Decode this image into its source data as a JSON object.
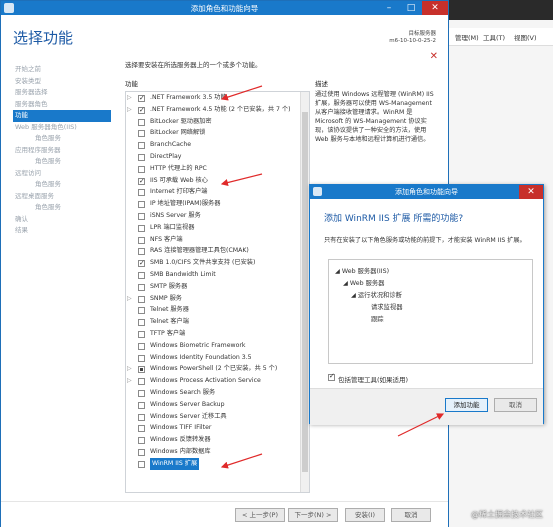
{
  "main_window": {
    "title": "添加角色和功能向导",
    "page_title": "选择功能",
    "dest_label": "目标服务器",
    "dest_server": "m6-10-10-0-25-2",
    "intro": "选择要安装在所选服务器上的一个或多个功能。",
    "features_header": "功能",
    "description_header": "描述",
    "description": "通过使用 Windows 远程管理 (WinRM) IIS 扩展，服务器可以使用 WS-Management 从客户端接收管理请求。WinRM 是 Microsoft 的 WS-Management 协议实现，该协议提供了一种安全的方法，使用 Web 服务与本地和远程计算机进行通信。"
  },
  "nav": [
    {
      "label": "开始之前",
      "sub": false,
      "active": false
    },
    {
      "label": "安装类型",
      "sub": false,
      "active": false
    },
    {
      "label": "服务器选择",
      "sub": false,
      "active": false
    },
    {
      "label": "服务器角色",
      "sub": false,
      "active": false
    },
    {
      "label": "功能",
      "sub": false,
      "active": true
    },
    {
      "label": "Web 服务器角色(IIS)",
      "sub": false,
      "active": false
    },
    {
      "label": "角色服务",
      "sub": true,
      "active": false
    },
    {
      "label": "应用程序服务器",
      "sub": false,
      "active": false
    },
    {
      "label": "角色服务",
      "sub": true,
      "active": false
    },
    {
      "label": "远程访问",
      "sub": false,
      "active": false
    },
    {
      "label": "角色服务",
      "sub": true,
      "active": false
    },
    {
      "label": "远程桌面服务",
      "sub": false,
      "active": false
    },
    {
      "label": "角色服务",
      "sub": true,
      "active": false
    },
    {
      "label": "确认",
      "sub": false,
      "active": false
    },
    {
      "label": "结果",
      "sub": false,
      "active": false
    }
  ],
  "features": [
    {
      "label": ".NET Framework 3.5 功能",
      "state": "checked",
      "expandable": true
    },
    {
      "label": ".NET Framework 4.5 功能 (2 个已安装，共 7 个)",
      "state": "checked",
      "expandable": true
    },
    {
      "label": "BitLocker 驱动器加密",
      "state": "unchecked",
      "expandable": false
    },
    {
      "label": "BitLocker 网络解锁",
      "state": "unchecked",
      "expandable": false
    },
    {
      "label": "BranchCache",
      "state": "unchecked",
      "expandable": false
    },
    {
      "label": "DirectPlay",
      "state": "unchecked",
      "expandable": false
    },
    {
      "label": "HTTP 代理上的 RPC",
      "state": "unchecked",
      "expandable": false
    },
    {
      "label": "IIS 可承载 Web 核心",
      "state": "checked",
      "expandable": false
    },
    {
      "label": "Internet 打印客户端",
      "state": "unchecked",
      "expandable": false
    },
    {
      "label": "IP 地址管理(IPAM)服务器",
      "state": "unchecked",
      "expandable": false
    },
    {
      "label": "iSNS Server 服务",
      "state": "unchecked",
      "expandable": false
    },
    {
      "label": "LPR 端口监视器",
      "state": "unchecked",
      "expandable": false
    },
    {
      "label": "NFS 客户端",
      "state": "unchecked",
      "expandable": false
    },
    {
      "label": "RAS 连接管理器管理工具包(CMAK)",
      "state": "unchecked",
      "expandable": false
    },
    {
      "label": "SMB 1.0/CIFS 文件共享支持 (已安装)",
      "state": "checked",
      "expandable": false
    },
    {
      "label": "SMB Bandwidth Limit",
      "state": "unchecked",
      "expandable": false
    },
    {
      "label": "SMTP 服务器",
      "state": "unchecked",
      "expandable": false
    },
    {
      "label": "SNMP 服务",
      "state": "unchecked",
      "expandable": true
    },
    {
      "label": "Telnet 服务器",
      "state": "unchecked",
      "expandable": false
    },
    {
      "label": "Telnet 客户端",
      "state": "unchecked",
      "expandable": false
    },
    {
      "label": "TFTP 客户端",
      "state": "unchecked",
      "expandable": false
    },
    {
      "label": "Windows Biometric Framework",
      "state": "unchecked",
      "expandable": false
    },
    {
      "label": "Windows Identity Foundation 3.5",
      "state": "unchecked",
      "expandable": false
    },
    {
      "label": "Windows PowerShell (2 个已安装，共 5 个)",
      "state": "partial",
      "expandable": true
    },
    {
      "label": "Windows Process Activation Service",
      "state": "unchecked",
      "expandable": true
    },
    {
      "label": "Windows Search 服务",
      "state": "unchecked",
      "expandable": false
    },
    {
      "label": "Windows Server Backup",
      "state": "unchecked",
      "expandable": false
    },
    {
      "label": "Windows Server 迁移工具",
      "state": "unchecked",
      "expandable": false
    },
    {
      "label": "Windows TIFF IFilter",
      "state": "unchecked",
      "expandable": false
    },
    {
      "label": "Windows 反馈转发器",
      "state": "unchecked",
      "expandable": false
    },
    {
      "label": "Windows 内部数据库",
      "state": "unchecked",
      "expandable": false
    },
    {
      "label": "WinRM IIS 扩展",
      "state": "unchecked",
      "expandable": false,
      "highlight": true
    }
  ],
  "footer": {
    "prev": "< 上一步(P)",
    "next": "下一步(N) >",
    "install": "安装(I)",
    "cancel": "取消"
  },
  "background": {
    "menu_manage": "管理(M)",
    "menu_tools": "工具(T)",
    "menu_view": "视图(V)"
  },
  "popup": {
    "title": "添加角色和功能向导",
    "heading": "添加 WinRM IIS 扩展 所需的功能?",
    "desc": "只有在安装了以下角色服务或功能的前提下，才能安装 WinRM IIS 扩展。",
    "tree": [
      "Web 服务器(IIS)",
      "Web 服务器",
      "运行状况和诊断",
      "请求监视器",
      "跟踪"
    ],
    "include_tools": "包括管理工具(如果适用)",
    "add_button": "添加功能",
    "cancel_button": "取消"
  },
  "watermark": "@稀土掘金技术社区",
  "colors": {
    "accent": "#1979ca",
    "title_text": "#1d5aa5",
    "close": "#c7302b",
    "arrow": "#e02a2a"
  }
}
